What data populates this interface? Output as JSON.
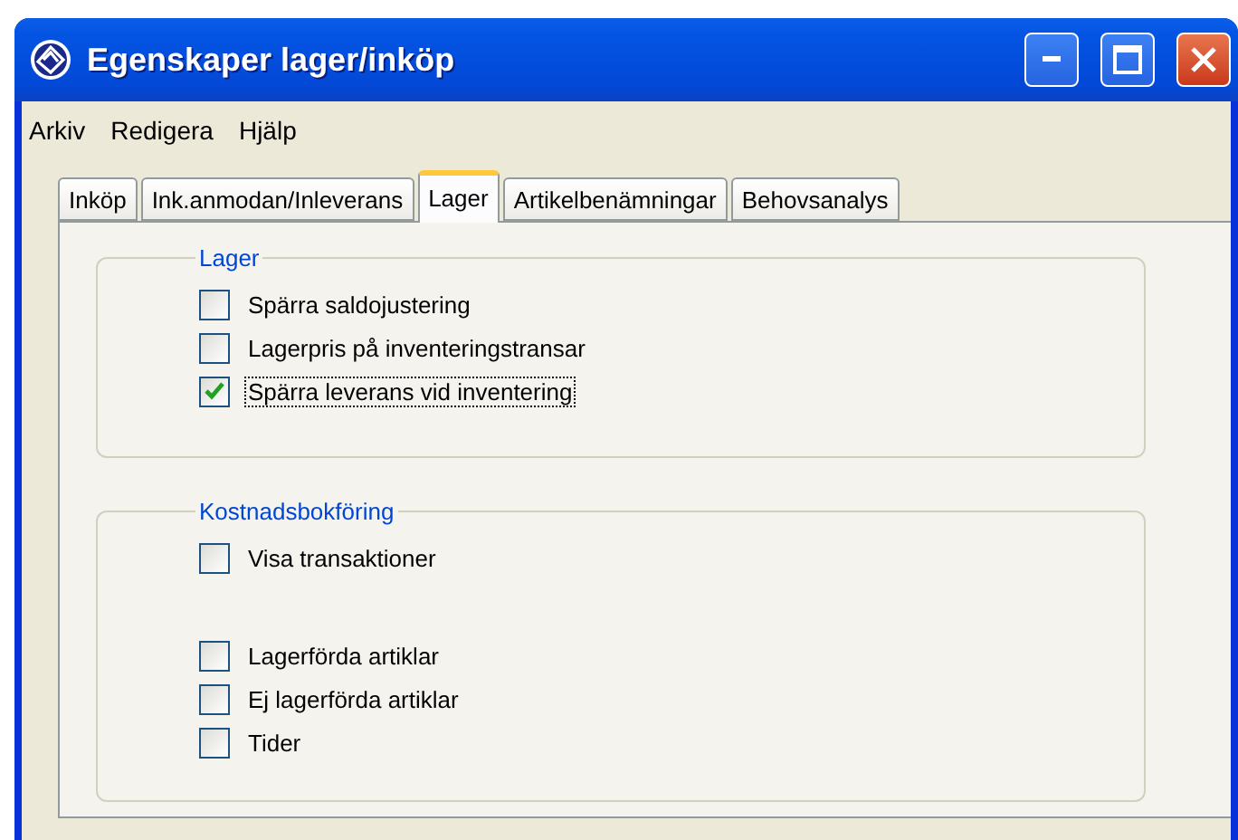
{
  "window": {
    "title": "Egenskaper lager/inköp"
  },
  "menu": [
    "Arkiv",
    "Redigera",
    "Hjälp"
  ],
  "tabs": [
    {
      "label": "Inköp",
      "selected": false
    },
    {
      "label": "Ink.anmodan/Inleverans",
      "selected": false
    },
    {
      "label": "Lager",
      "selected": true
    },
    {
      "label": "Artikelbenämningar",
      "selected": false
    },
    {
      "label": "Behovsanalys",
      "selected": false
    }
  ],
  "groups": [
    {
      "title": "Lager",
      "sections": [
        [
          {
            "label": "Spärra saldojustering",
            "checked": false,
            "focused": false
          },
          {
            "label": "Lagerpris på inventeringstransar",
            "checked": false,
            "focused": false
          },
          {
            "label": "Spärra leverans vid inventering",
            "checked": true,
            "focused": true
          }
        ]
      ]
    },
    {
      "title": "Kostnadsbokföring",
      "sections": [
        [
          {
            "label": "Visa transaktioner",
            "checked": false,
            "focused": false
          }
        ],
        [
          {
            "label": "Lagerförda artiklar",
            "checked": false,
            "focused": false
          },
          {
            "label": "Ej lagerförda artiklar",
            "checked": false,
            "focused": false
          },
          {
            "label": "Tider",
            "checked": false,
            "focused": false
          }
        ]
      ]
    }
  ]
}
